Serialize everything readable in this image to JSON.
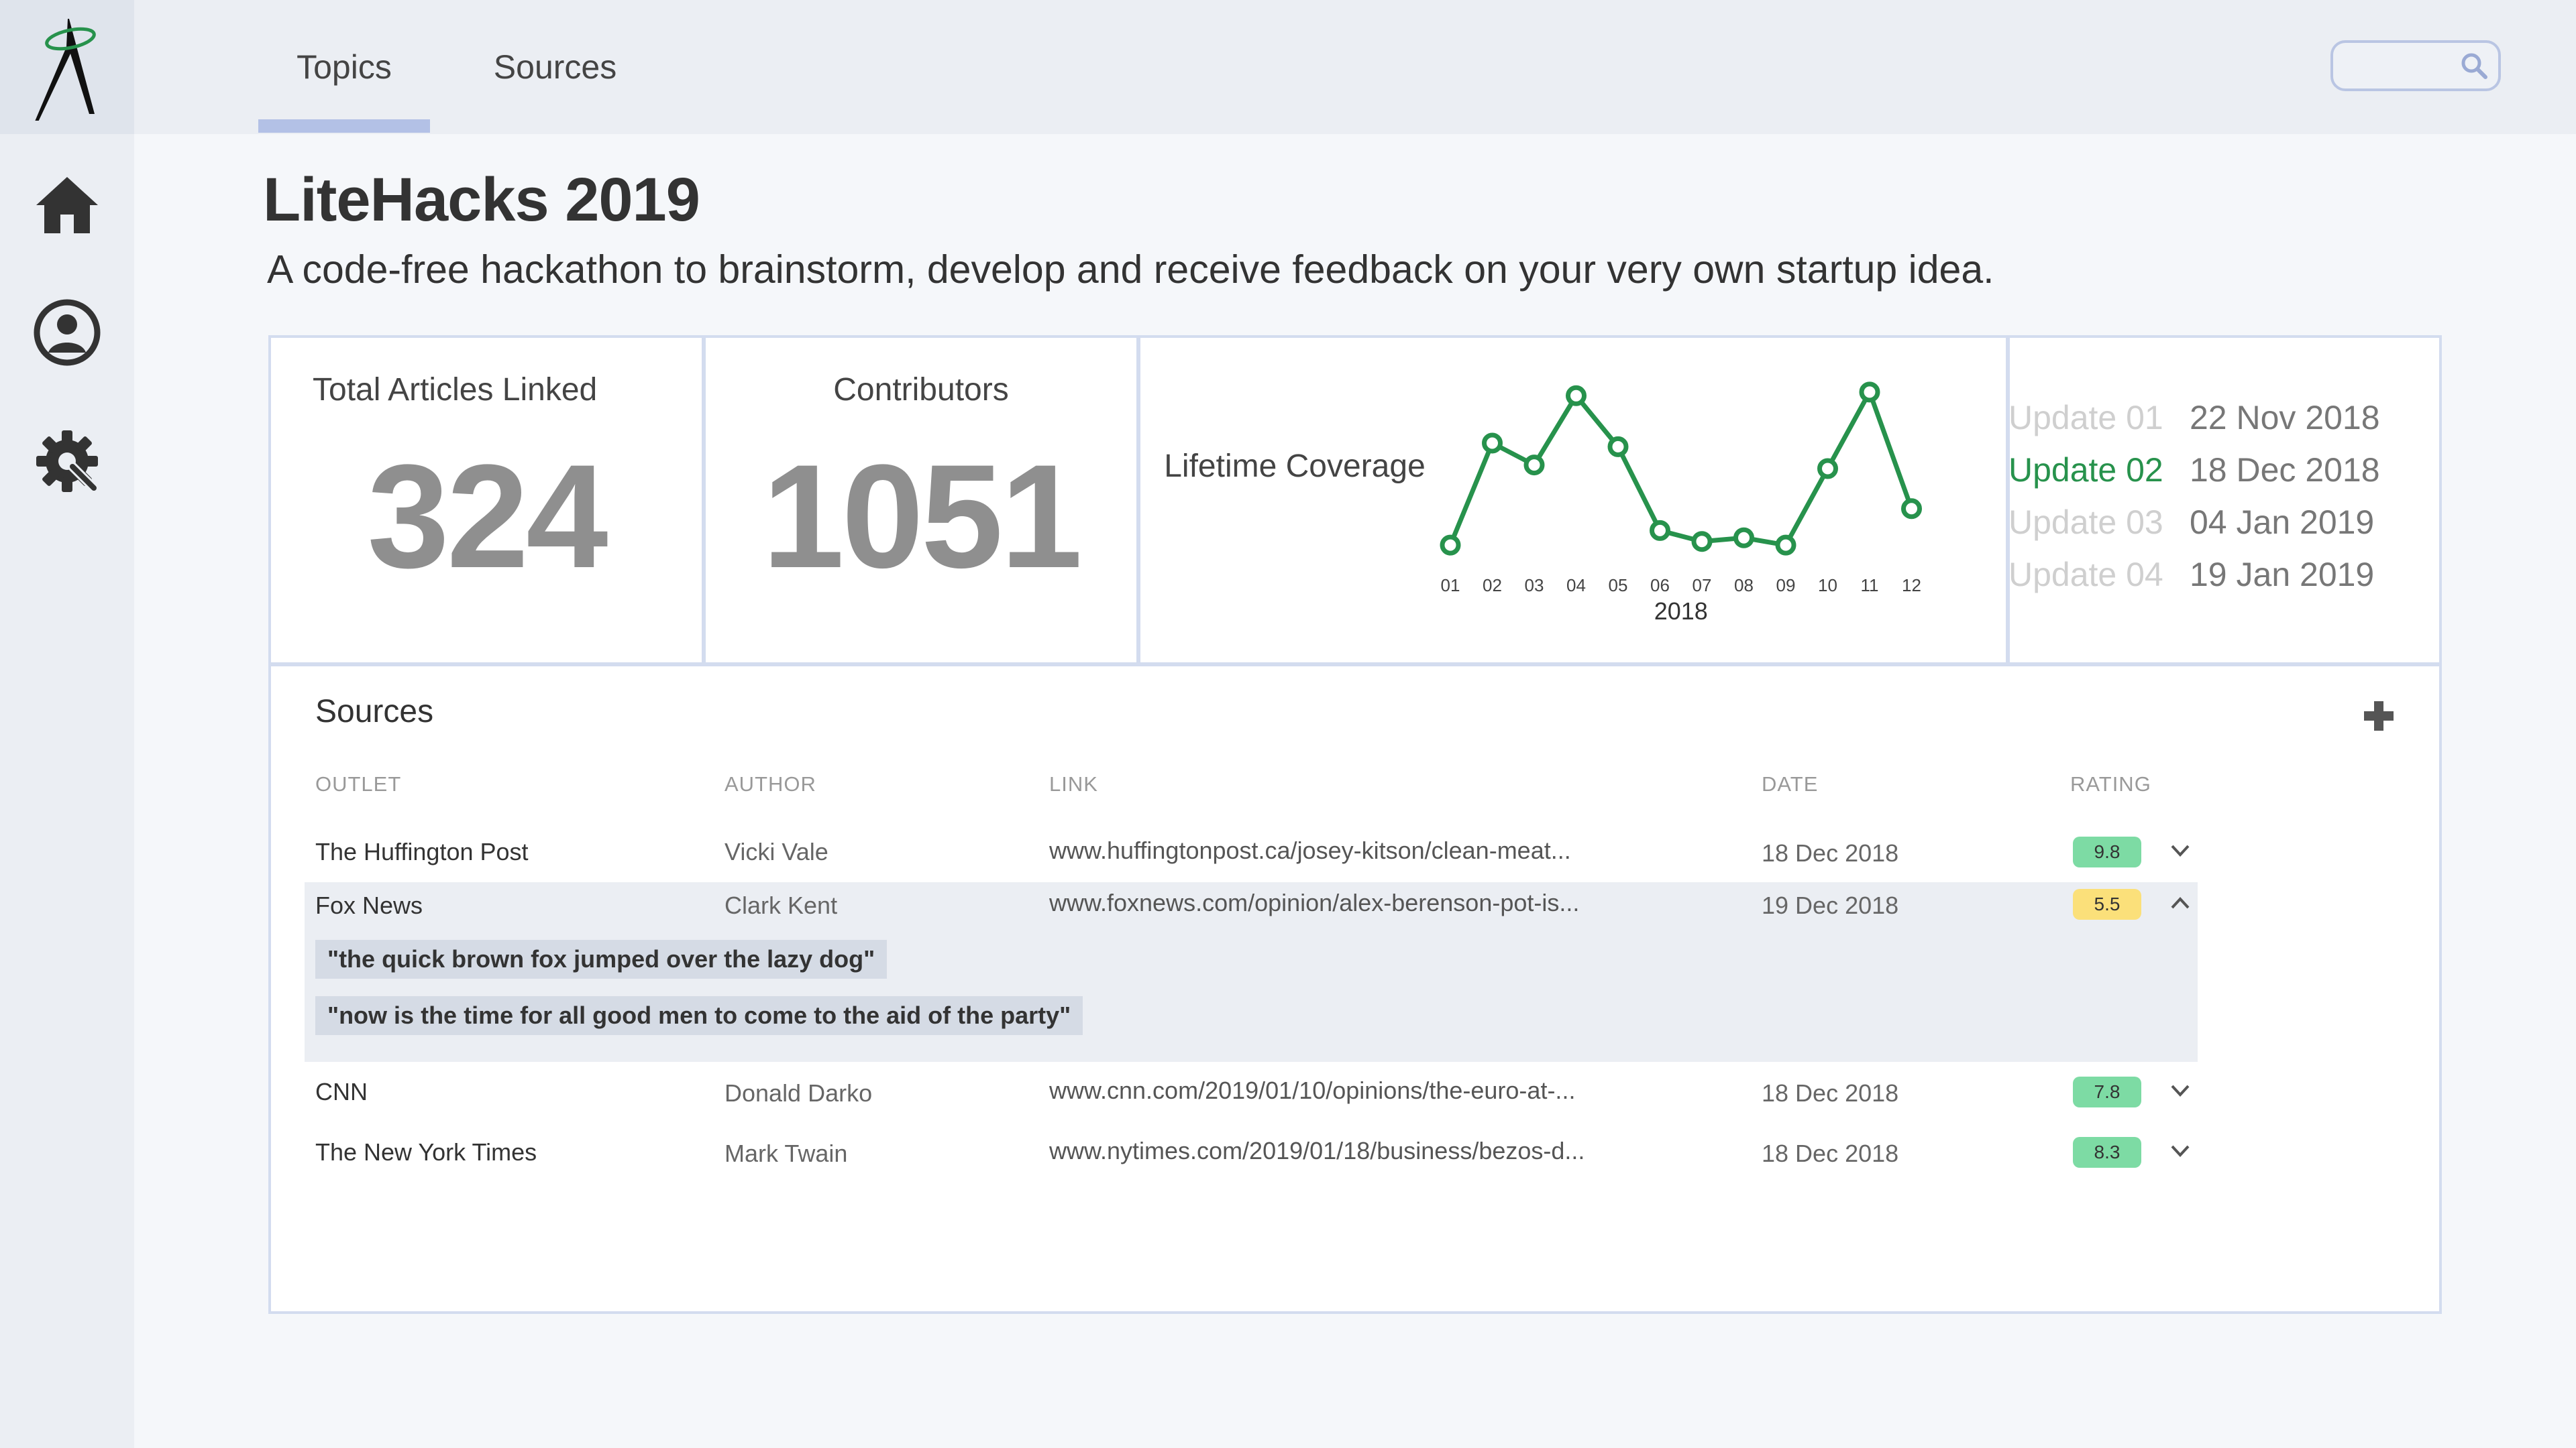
{
  "nav": {
    "logo_icon": "compass-logo",
    "items": [
      {
        "icon": "home-icon"
      },
      {
        "icon": "profile-icon"
      },
      {
        "icon": "settings-icon"
      }
    ]
  },
  "header": {
    "tabs": [
      {
        "label": "Topics",
        "active": true
      },
      {
        "label": "Sources",
        "active": false
      }
    ],
    "search": {
      "placeholder": "",
      "icon": "search-icon"
    }
  },
  "page": {
    "title": "LiteHacks 2019",
    "subtitle": "A code-free hackathon to brainstorm, develop and receive feedback on your very own startup idea."
  },
  "stats": {
    "articles": {
      "label": "Total Articles Linked",
      "value": "324"
    },
    "contributors": {
      "label": "Contributors",
      "value": "1051"
    },
    "coverage": {
      "label": "Lifetime Coverage"
    }
  },
  "chart_data": {
    "type": "line",
    "x": [
      "01",
      "02",
      "03",
      "04",
      "05",
      "06",
      "07",
      "08",
      "09",
      "10",
      "11",
      "12"
    ],
    "values": [
      2,
      30,
      24,
      43,
      29,
      6,
      3,
      4,
      2,
      23,
      44,
      12
    ],
    "xlabel": "2018",
    "ylabel": "",
    "ylim": [
      0,
      46
    ],
    "grid": false,
    "color": "#27924c"
  },
  "updates": [
    {
      "name": "Update 01",
      "date": "22 Nov 2018",
      "current": false
    },
    {
      "name": "Update 02",
      "date": "18 Dec 2018",
      "current": true
    },
    {
      "name": "Update 03",
      "date": "04 Jan 2019",
      "current": false
    },
    {
      "name": "Update 04",
      "date": "19 Jan 2019",
      "current": false
    }
  ],
  "sources": {
    "title": "Sources",
    "add_icon": "plus-icon",
    "columns": {
      "outlet": "OUTLET",
      "author": "AUTHOR",
      "link": "LINK",
      "date": "DATE",
      "rating": "RATING"
    },
    "rows": [
      {
        "outlet": "The Huffington Post",
        "author": "Vicki Vale",
        "link": "www.huffingtonpost.ca/josey-kitson/clean-meat...",
        "date": "18 Dec 2018",
        "rating": "9.8",
        "rating_color": "#7ddba4",
        "expanded": false,
        "quotes": []
      },
      {
        "outlet": "Fox News",
        "author": "Clark Kent",
        "link": "www.foxnews.com/opinion/alex-berenson-pot-is...",
        "date": "19 Dec 2018",
        "rating": "5.5",
        "rating_color": "#fbe07a",
        "expanded": true,
        "quotes": [
          "\"the quick brown fox jumped over the lazy dog\"",
          "\"now is the time for all good men to come to the aid of the party\""
        ]
      },
      {
        "outlet": "CNN",
        "author": "Donald Darko",
        "link": "www.cnn.com/2019/01/10/opinions/the-euro-at-...",
        "date": "18 Dec 2018",
        "rating": "7.8",
        "rating_color": "#7ddba4",
        "expanded": false,
        "quotes": []
      },
      {
        "outlet": "The New York Times",
        "author": "Mark Twain",
        "link": "www.nytimes.com/2019/01/18/business/bezos-d...",
        "date": "18 Dec 2018",
        "rating": "8.3",
        "rating_color": "#7ddba4",
        "expanded": false,
        "quotes": []
      }
    ]
  }
}
